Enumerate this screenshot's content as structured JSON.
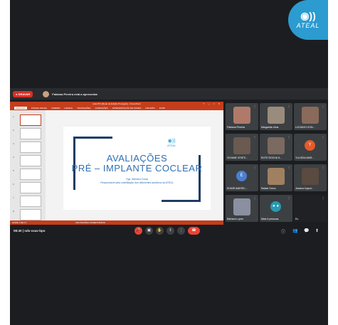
{
  "logo": {
    "text": "ATEAL",
    "mark": "◉))"
  },
  "banner": {
    "rec_label": "● GRAVAR",
    "text": "Fabiana Pereira está a apresentar"
  },
  "ppt": {
    "title": "Aula PIC [Modo de Edição Protegido] - PowerPoint",
    "window_controls": "? — □ ✕",
    "ribbon_tabs": [
      "ARQUIVO",
      "PÁGINA INICIAL",
      "INSERIR",
      "DESIGN",
      "TRANSIÇÕES",
      "ANIMAÇÕES",
      "APRESENTAÇÃO DE SLIDES",
      "REVISÃO",
      "EXIBI"
    ],
    "thumb_numbers": [
      "1",
      "2",
      "3",
      "4",
      "5",
      "6",
      "7",
      "8"
    ],
    "status_left": "SLIDE 1 DE 17",
    "status_mid": "ANOTAÇÕES    COMENTÁRIOS",
    "slide": {
      "logo_mark": "◉))",
      "logo_text": "ATEAL",
      "title_line1": "AVALIAÇÕES",
      "title_line2": "PRÉ – IMPLANTE COCLEAR",
      "author_line1": "Fga. Bárbara Costa",
      "author_line2": "Responsável pela reabilitação dos deficientes auditivos da ATEAL"
    }
  },
  "participants": [
    {
      "name": "Fabiana Pereira",
      "type": "photo",
      "color": "#b07a6a"
    },
    {
      "name": "Margarida Lima",
      "type": "photo",
      "color": "#9a8c7c"
    },
    {
      "name": "LUCIANO GON...",
      "type": "photo",
      "color": "#8a6a5a"
    },
    {
      "name": "VIVIANE CRISTI...",
      "type": "photo",
      "color": "#6a5a50"
    },
    {
      "name": "RUTE ROCHA S...",
      "type": "photo",
      "color": "#7a6a60"
    },
    {
      "name": "YULISSA MAR...",
      "type": "avatar",
      "letter": "Y",
      "color": "#e65a2a"
    },
    {
      "name": "EDMIR AMERIC...",
      "type": "avatar",
      "letter": "E",
      "color": "#4a7fd0"
    },
    {
      "name": "Rafael Greco",
      "type": "photo",
      "color": "#a08060"
    },
    {
      "name": "Jessica Caproi...",
      "type": "photo",
      "color": "#5a4a40"
    },
    {
      "name": "Bárbara Lopes",
      "type": "photo",
      "color": "#8a90a0"
    },
    {
      "name": "Mais 6 pessoas",
      "type": "avatar",
      "letter": "● ●",
      "color": "#2a9ab0"
    },
    {
      "name": "Eu",
      "type": "blank",
      "color": "#202124"
    }
  ],
  "toolbar": {
    "meeting_info": "08:40  |  ndx-vxav-bpo",
    "mic_icon": "🎤",
    "cam_icon": "▣",
    "hand_icon": "✋",
    "present_icon": "⇪",
    "more_icon": "⋮",
    "end_icon": "☎",
    "right_icons": [
      "ⓘ",
      "👥",
      "💬",
      "⬆"
    ]
  }
}
